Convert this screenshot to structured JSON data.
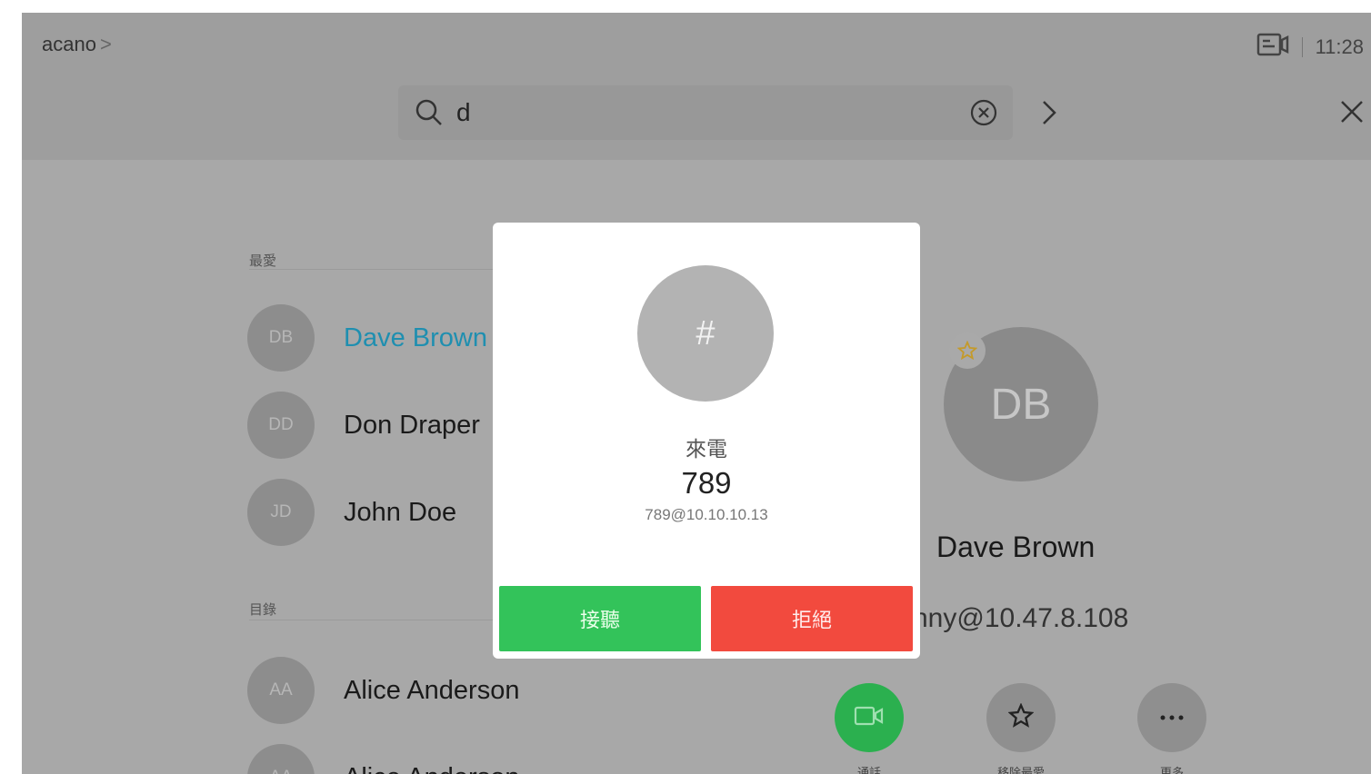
{
  "header": {
    "brand": "acano",
    "brand_chevron": ">",
    "time": "11:28",
    "status_icon": "camera-screen-icon"
  },
  "search": {
    "query": "d",
    "placeholder": ""
  },
  "sections": {
    "favorites_label": "最愛",
    "directory_label": "目錄"
  },
  "contacts": [
    {
      "initials": "DB",
      "name": "Dave Brown",
      "highlight": true
    },
    {
      "initials": "DD",
      "name": "Don Draper",
      "highlight": false
    },
    {
      "initials": "JD",
      "name": "John Doe",
      "highlight": false
    },
    {
      "initials": "AA",
      "name": "Alice Anderson",
      "highlight": false
    },
    {
      "initials": "AA",
      "name": "Alice Anderson",
      "highlight": false
    }
  ],
  "detail": {
    "initials": "DB",
    "name": "Dave Brown",
    "uri": "nny@10.47.8.108",
    "actions": [
      {
        "label": "通話",
        "icon": "video-call-icon"
      },
      {
        "label": "移除最愛",
        "icon": "star-icon"
      },
      {
        "label": "更多",
        "icon": "more-icon"
      }
    ]
  },
  "incoming_call": {
    "avatar": "#",
    "status": "來電",
    "caller": "789",
    "uri": "789@10.10.10.13",
    "accept_label": "接聽",
    "decline_label": "拒絕"
  },
  "colors": {
    "accept": "#33c35a",
    "decline": "#f24a3e",
    "highlight": "#1f8fb0",
    "call_button": "#2bb04f"
  }
}
